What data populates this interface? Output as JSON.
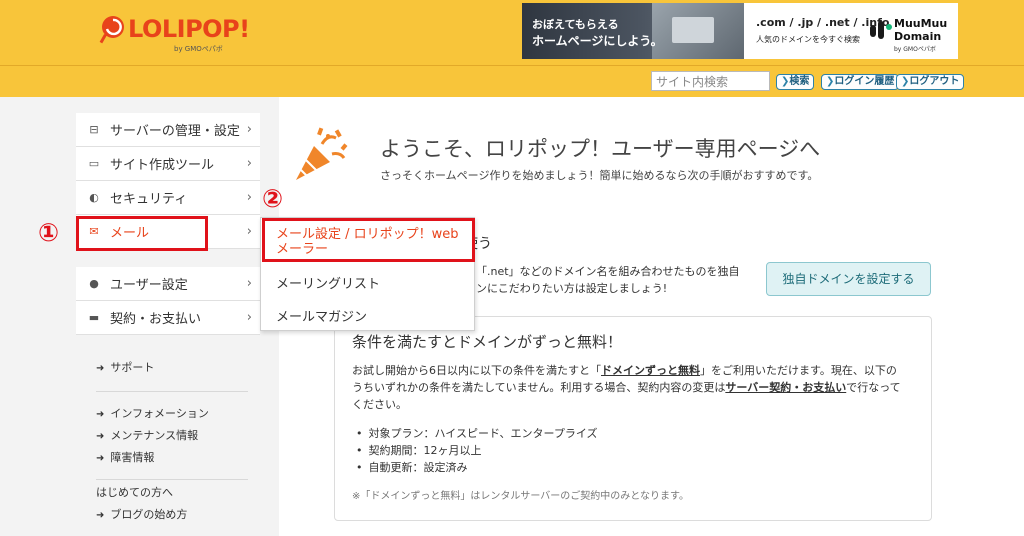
{
  "header": {
    "logo_text": "LOLIPOP!",
    "logo_sub": "by GMOペパボ",
    "banner": {
      "line1": "おぼえてもらえる",
      "line2": "ホームページにしよう。",
      "domains": ".com / .jp / .net / .info",
      "domains_sub": "人気のドメインを今すぐ検索",
      "brand": "MuuMuu Domain",
      "brand_line1": "MuuMuu",
      "brand_line2": "Domain",
      "brand_sub": "by GMOペパボ"
    },
    "search_placeholder": "サイト内検索",
    "buttons": {
      "search": "検索",
      "login_history": "ログイン履歴",
      "logout": "ログアウト"
    },
    "colors": {
      "bar": "#f8c53a",
      "logo": "#e8431b"
    }
  },
  "sidebar": {
    "items": [
      {
        "icon": "server-icon",
        "label": "サーバーの管理・設定"
      },
      {
        "icon": "laptop-icon",
        "label": "サイト作成ツール"
      },
      {
        "icon": "shield-icon",
        "label": "セキュリティ"
      },
      {
        "icon": "mail-icon",
        "label": "メール"
      }
    ],
    "items2": [
      {
        "icon": "user-icon",
        "label": "ユーザー設定"
      },
      {
        "icon": "card-icon",
        "label": "契約・お支払い"
      }
    ],
    "links": {
      "support": "サポート",
      "information": "インフォメーション",
      "maintenance": "メンテナンス情報",
      "failure": "障害情報",
      "beginners_label": "はじめての方へ",
      "blog_start": "ブログの始め方"
    }
  },
  "dropdown": {
    "item1_line1": "メール設定 / ロリポップ！web",
    "item1_line2": "メーラー",
    "item2": "メーリングリスト",
    "item3": "メールマガジン"
  },
  "annotations": {
    "step1": "①",
    "step2": "②",
    "color": "#e0121a"
  },
  "main": {
    "welcome_title": "ようこそ、ロリポップ！ユーザー専用ページへ",
    "welcome_sub": "さっそくホームページ作りを始めましょう！簡単に始めるなら次の手順がおすすめです。",
    "domain": {
      "title": "ンを使う",
      "text1": "「.net」などのドメイン名を組み合わせたものを独自",
      "text2": "ンにこだわりたい方は設定しましょう!",
      "button": "独自ドメインを設定する"
    },
    "free": {
      "title": "条件を満たすとドメインがずっと無料！",
      "p1_a": "お試し開始から6日以内に以下の条件を満たすと「",
      "p1_link": "ドメインずっと無料",
      "p1_b": "」をご利用いただけます。現在、以下の",
      "p2_a": "うちいずれかの条件を満たしていません。利用する場合、契約内容の変更は",
      "p2_link": "サーバー契約・お支払い",
      "p2_b": "で行なって",
      "p3": "ください。",
      "list": [
        "対象プラン：ハイスピード、エンタープライズ",
        "契約期間：12ヶ月以上",
        "自動更新：設定済み"
      ],
      "note": "※「ドメインずっと無料」はレンタルサーバーのご契約中のみとなります。"
    }
  }
}
